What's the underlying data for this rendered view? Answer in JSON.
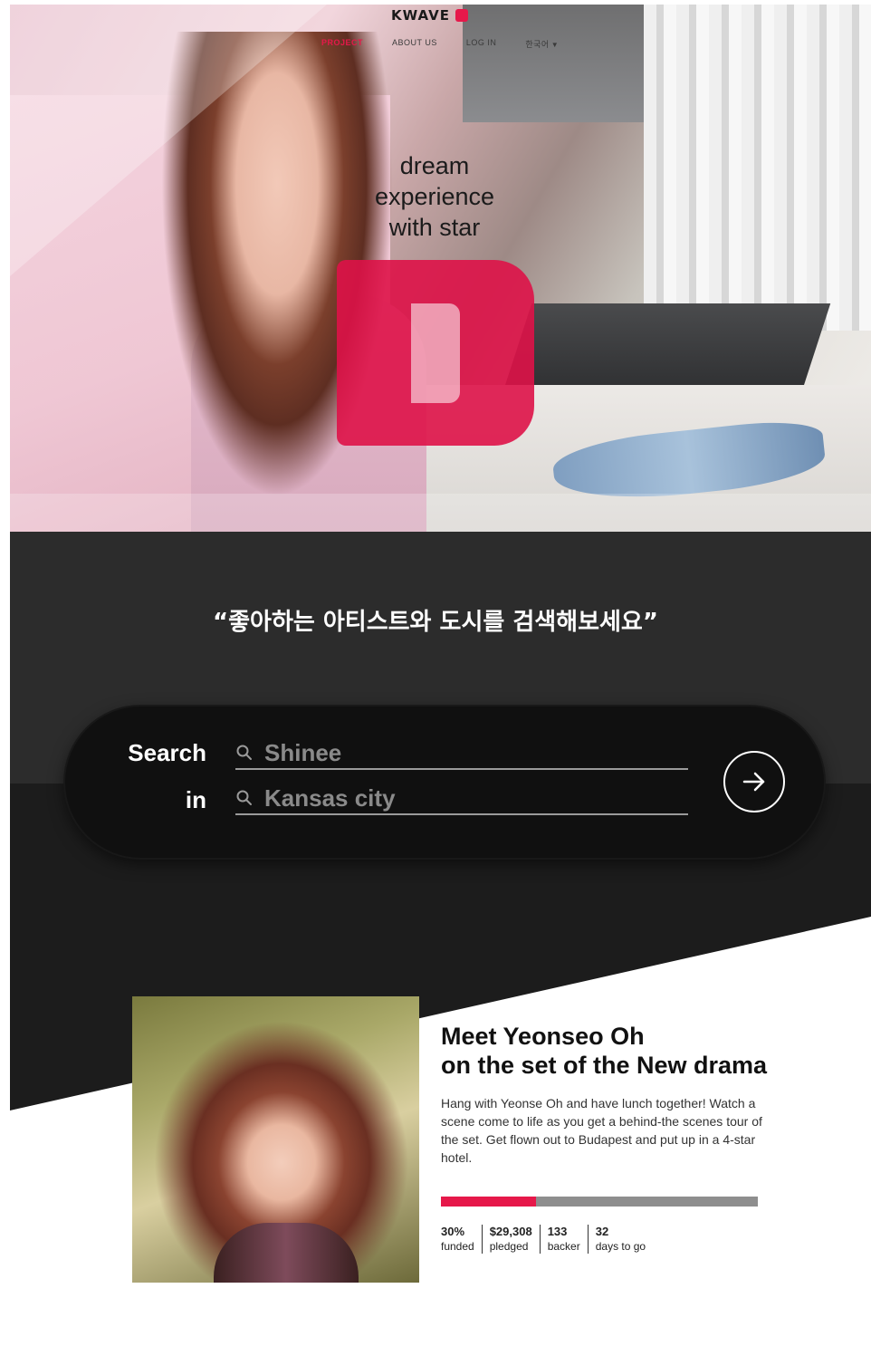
{
  "brand": {
    "logo_text": "KWAVE"
  },
  "nav": {
    "items": [
      "PROJECT",
      "ABOUT US",
      "LOG IN",
      "한국어"
    ]
  },
  "hero": {
    "tagline_lines": [
      "dream",
      "experience",
      "with star"
    ]
  },
  "search": {
    "prompt": "“좋아하는 아티스트와 도시를 검색해보세요”",
    "label_artist": "Search",
    "label_city": "in",
    "artist_placeholder": "Shinee",
    "city_placeholder": "Kansas city"
  },
  "project": {
    "title_line1": "Meet Yeonseo Oh",
    "title_line2": "on the set of the New drama",
    "description": "Hang with Yeonse Oh and have lunch together! Watch a scene come to life as you get a behind-the scenes tour of the set. Get flown out to Budapest and put up in a 4-star hotel.",
    "progress_percent": 30,
    "stats": [
      {
        "value": "30%",
        "label": "funded"
      },
      {
        "value": "$29,308",
        "label": "pledged"
      },
      {
        "value": "133",
        "label": "backer"
      },
      {
        "value": "32",
        "label": "days to go"
      }
    ]
  },
  "colors": {
    "accent": "#e6184a",
    "dark": "#1c1c1c",
    "dark_upper": "#2c2c2c"
  }
}
